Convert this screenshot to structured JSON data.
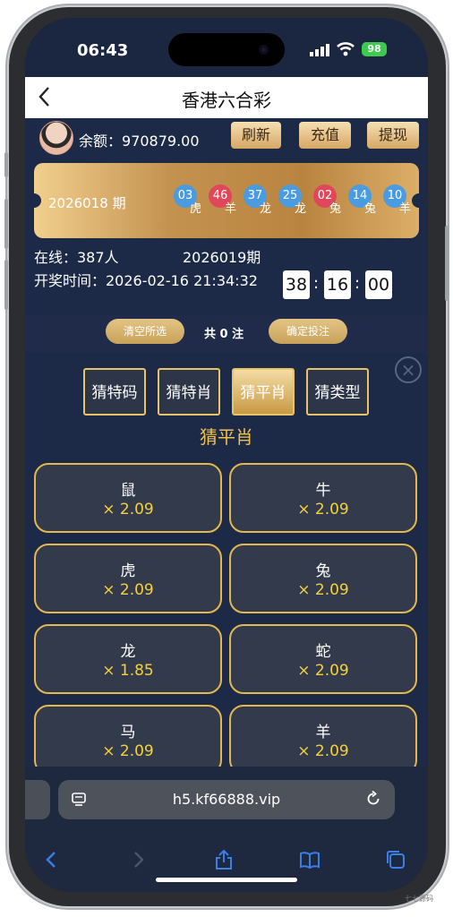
{
  "status": {
    "time": "06:43",
    "battery": "98"
  },
  "header": {
    "title": "香港六合彩"
  },
  "account": {
    "balance_label": "余额：",
    "balance": "970879.00",
    "refresh": "刷新",
    "recharge": "充值",
    "withdraw": "提现"
  },
  "last_draw": {
    "period": "2026018 期",
    "balls": [
      {
        "num": "03",
        "zodiac": "虎",
        "color": "#4a9be0"
      },
      {
        "num": "46",
        "zodiac": "羊",
        "color": "#e0475a"
      },
      {
        "num": "37",
        "zodiac": "龙",
        "color": "#4a9be0"
      },
      {
        "num": "25",
        "zodiac": "龙",
        "color": "#4a9be0"
      },
      {
        "num": "02",
        "zodiac": "兔",
        "color": "#e0475a"
      },
      {
        "num": "14",
        "zodiac": "兔",
        "color": "#4a9be0"
      },
      {
        "num": "10",
        "zodiac": "羊",
        "color": "#4a9be0"
      }
    ]
  },
  "info": {
    "online": "在线：387人",
    "next_period": "2026019期",
    "draw_time": "开奖时间：2026-02-16 21:34:32",
    "countdown": [
      "38",
      "16",
      "00"
    ]
  },
  "bet_bar": {
    "clear": "清空所选",
    "count": "共 0 注",
    "confirm": "确定投注"
  },
  "tabs": [
    {
      "label": "猜特码",
      "active": false
    },
    {
      "label": "猜特肖",
      "active": false
    },
    {
      "label": "猜平肖",
      "active": true
    },
    {
      "label": "猜类型",
      "active": false
    }
  ],
  "section_title": "猜平肖",
  "options": [
    {
      "name": "鼠",
      "odds": "× 2.09"
    },
    {
      "name": "牛",
      "odds": "× 2.09"
    },
    {
      "name": "虎",
      "odds": "× 2.09"
    },
    {
      "name": "兔",
      "odds": "× 2.09"
    },
    {
      "name": "龙",
      "odds": "× 1.85"
    },
    {
      "name": "蛇",
      "odds": "× 2.09"
    },
    {
      "name": "马",
      "odds": "× 2.09"
    },
    {
      "name": "羊",
      "odds": "× 2.09"
    }
  ],
  "browser": {
    "url": "h5.kf66888.vip"
  },
  "watermark": "七七源码"
}
